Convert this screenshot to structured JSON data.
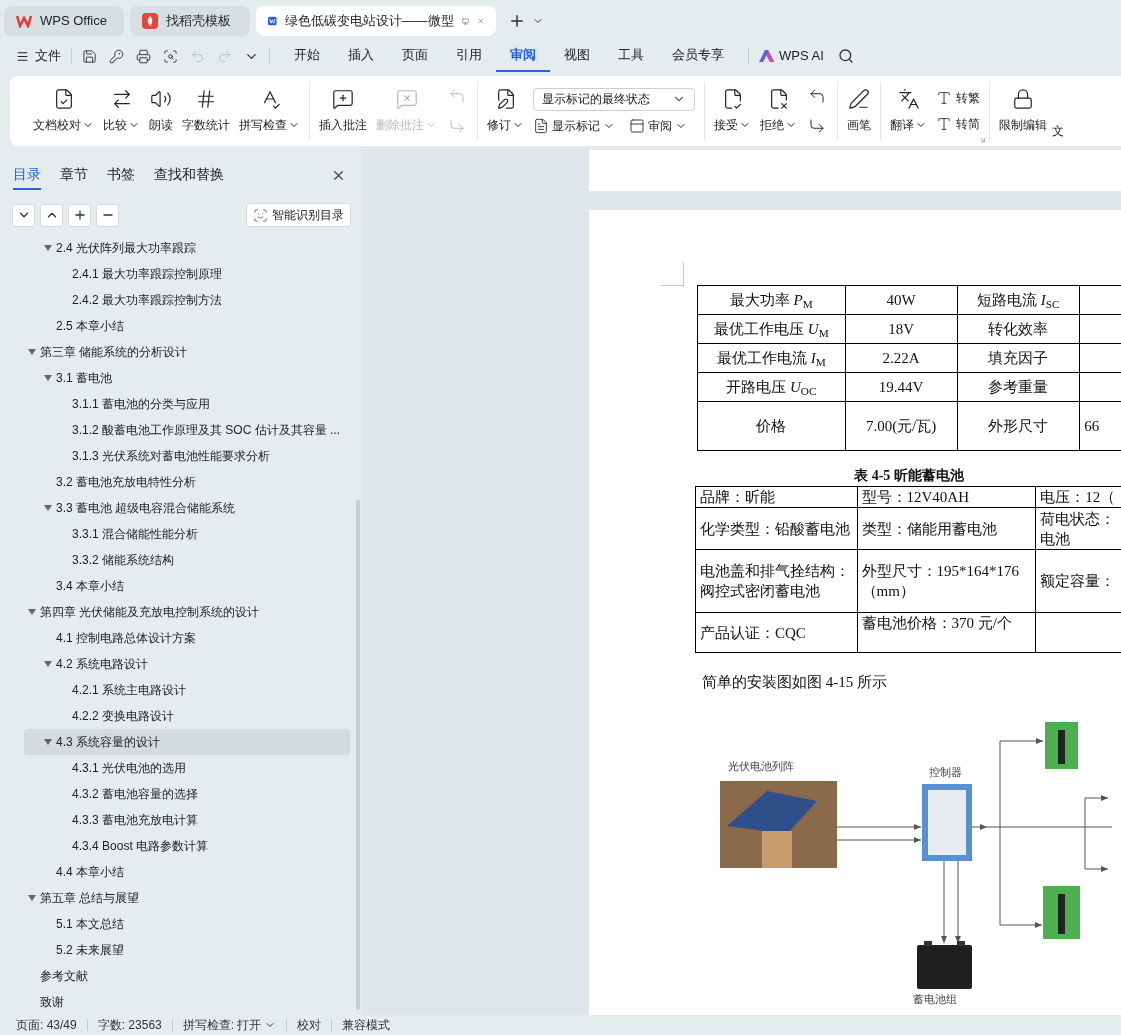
{
  "window_tabs": [
    {
      "label": "WPS Office",
      "selected": false
    },
    {
      "label": "找稻壳模板",
      "selected": false
    },
    {
      "label": "绿色低碳变电站设计——微型",
      "selected": true
    }
  ],
  "quick_access": {
    "file_label": "文件",
    "undo": {
      "disabled": true
    },
    "redo": {
      "disabled": true
    }
  },
  "menu_tabs": [
    {
      "label": "开始",
      "selected": false
    },
    {
      "label": "插入",
      "selected": false
    },
    {
      "label": "页面",
      "selected": false
    },
    {
      "label": "引用",
      "selected": false
    },
    {
      "label": "审阅",
      "selected": true
    },
    {
      "label": "视图",
      "selected": false
    },
    {
      "label": "工具",
      "selected": false
    },
    {
      "label": "会员专享",
      "selected": false
    }
  ],
  "ai_label": "WPS AI",
  "ribbon": [
    {
      "launcher": false,
      "items": [
        {
          "kind": "large",
          "label": "文档校对",
          "dropdown": true,
          "disabled": false
        },
        {
          "kind": "large",
          "label": "比较",
          "dropdown": true,
          "disabled": false
        },
        {
          "kind": "large",
          "label": "朗读",
          "dropdown": false,
          "disabled": false
        },
        {
          "kind": "large",
          "label": "字数统计",
          "dropdown": false,
          "disabled": false
        },
        {
          "kind": "large",
          "label": "拼写检查",
          "dropdown": true,
          "disabled": false
        }
      ]
    },
    {
      "launcher": false,
      "items": [
        {
          "kind": "large",
          "label": "插入批注",
          "dropdown": false,
          "disabled": false
        },
        {
          "kind": "large",
          "label": "删除批注",
          "dropdown": true,
          "disabled": true
        },
        {
          "kind": "icon_stack",
          "disabled": true
        }
      ]
    },
    {
      "launcher": false,
      "items": [
        {
          "kind": "large",
          "label": "修订",
          "dropdown": true,
          "disabled": false
        },
        {
          "kind": "select_block",
          "value": "显示标记的最终状态",
          "buttons": [
            {
              "label": "显示标记",
              "dropdown": true
            },
            {
              "label": "审阅",
              "dropdown": true
            }
          ]
        }
      ]
    },
    {
      "launcher": false,
      "items": [
        {
          "kind": "large",
          "label": "接受",
          "dropdown": true,
          "disabled": false
        },
        {
          "kind": "large",
          "label": "拒绝",
          "dropdown": true,
          "disabled": false
        },
        {
          "kind": "icon_stack",
          "disabled": false
        }
      ]
    },
    {
      "launcher": false,
      "items": [
        {
          "kind": "large",
          "label": "画笔",
          "dropdown": false,
          "disabled": false
        }
      ]
    },
    {
      "launcher": true,
      "items": [
        {
          "kind": "large",
          "label": "翻译",
          "dropdown": true,
          "disabled": false
        },
        {
          "kind": "small_stack",
          "buttons": [
            {
              "label": "转繁"
            },
            {
              "label": "转简"
            }
          ]
        }
      ]
    },
    {
      "launcher": false,
      "items": [
        {
          "kind": "large",
          "label": "限制编辑",
          "dropdown": false,
          "disabled": false
        },
        {
          "kind": "label_only",
          "label": "文"
        }
      ]
    }
  ],
  "nav_panel": {
    "tabs": [
      {
        "label": "目录",
        "selected": true
      },
      {
        "label": "章节",
        "selected": false
      },
      {
        "label": "书签",
        "selected": false
      },
      {
        "label": "查找和替换",
        "selected": false
      }
    ],
    "smart_button": "智能识别目录",
    "continued_sections": [
      {
        "label": "2.4 光伏阵列最大功率跟踪",
        "selected": false,
        "expanded": true,
        "children": [
          {
            "label": "2.4.1 最大功率跟踪控制原理",
            "selected": false
          },
          {
            "label": "2.4.2  最大功率跟踪控制方法",
            "selected": false
          }
        ]
      },
      {
        "label": "2.5  本章小结",
        "selected": false
      }
    ],
    "chapters": [
      {
        "label": "第三章  储能系统的分析设计",
        "selected": false,
        "expanded": true,
        "children": [
          {
            "label": "3.1  蓄电池",
            "selected": false,
            "expanded": true,
            "children": [
              {
                "label": "3.1.1 蓄电池的分类与应用",
                "selected": false
              },
              {
                "label": "3.1.2 酸蓄电池工作原理及其  SOC  估计及其容量 ...",
                "selected": false
              },
              {
                "label": "3.1.3  光伏系统对蓄电池性能要求分析",
                "selected": false
              }
            ]
          },
          {
            "label": "3.2 蓄电池充放电特性分析",
            "selected": false
          },
          {
            "label": "3.3  蓄电池  超级电容混合储能系统",
            "selected": false,
            "expanded": true,
            "children": [
              {
                "label": "3.3.1  混合储能性能分析",
                "selected": false
              },
              {
                "label": "3.3.2  储能系统结构",
                "selected": false
              }
            ]
          },
          {
            "label": "3.4 本章小结",
            "selected": false
          }
        ]
      },
      {
        "label": "第四章  光伏储能及充放电控制系统的设计",
        "selected": false,
        "expanded": true,
        "children": [
          {
            "label": "4.1 控制电路总体设计方案",
            "selected": false
          },
          {
            "label": "4.2 系统电路设计",
            "selected": false,
            "expanded": true,
            "children": [
              {
                "label": "4.2.1 系统主电路设计",
                "selected": false
              },
              {
                "label": "4.2.2  变换电路设计",
                "selected": false
              }
            ]
          },
          {
            "label": "4.3 系统容量的设计",
            "selected": true,
            "expanded": true,
            "children": [
              {
                "label": "4.3.1 光伏电池的选用",
                "selected": false
              },
              {
                "label": "4.3.2 蓄电池容量的选择",
                "selected": false
              },
              {
                "label": "4.3.3 蓄电池充放电计算",
                "selected": false
              },
              {
                "label": "4.3.4 Boost 电路参数计算",
                "selected": false
              }
            ]
          },
          {
            "label": "4.4 本章小结",
            "selected": false
          }
        ]
      },
      {
        "label": "第五章  总结与展望",
        "selected": false,
        "expanded": true,
        "children": [
          {
            "label": "5.1  本文总结",
            "selected": false
          },
          {
            "label": "5.2 未来展望",
            "selected": false
          }
        ]
      },
      {
        "label": "参考文献",
        "selected": false
      },
      {
        "label": "致谢",
        "selected": false
      }
    ]
  },
  "document": {
    "spec_table": {
      "rows": [
        {
          "cells": [
            "最大功率 *P*$_{M}$",
            "40W",
            "短路电流 *I*$_{SC}$"
          ]
        },
        {
          "cells": [
            "最优工作电压 *U*$_{M}$",
            "18V",
            "转化效率"
          ]
        },
        {
          "cells": [
            "最优工作电流 *I*$_{M}$",
            "2.22A",
            "填充因子"
          ]
        },
        {
          "cells": [
            "开路电压 *U*$_{OC}$",
            "19.44V",
            "参考重量"
          ]
        },
        {
          "cells": [
            "价格",
            "7.00(元/瓦)",
            "外形尺寸",
            "66"
          ]
        }
      ]
    },
    "battery_table": {
      "caption": "表 4-5 昕能蓄电池",
      "rows": [
        {
          "cells": [
            "品牌：昕能",
            "型号：12V40AH",
            "电压：12（"
          ]
        },
        {
          "cells": [
            "化学类型：铅酸蓄电池",
            "类型：储能用蓄电池",
            "荷电状态：电池"
          ]
        },
        {
          "cells": [
            "电池盖和排气拴结构：阀控式密闭蓄电池",
            "外型尺寸：195*164*176（mm）",
            "额定容量："
          ]
        },
        {
          "cells": [
            "产品认证：CQC",
            "蓄电池价格：370 元/个"
          ]
        }
      ]
    },
    "paragraph": "简单的安装图如图 4-15 所示",
    "diagram": {
      "solar_label": "光伏电池列阵",
      "controller_label": "控制器",
      "battery_label": "蓄电池组"
    }
  },
  "status_bar": [
    {
      "label": "页面: 43/49",
      "dropdown": false
    },
    {
      "label": "字数: 23563",
      "dropdown": false
    },
    {
      "label": "拼写检查: 打开",
      "dropdown": true
    },
    {
      "label": "校对",
      "dropdown": false
    },
    {
      "label": "兼容模式",
      "dropdown": false
    }
  ]
}
